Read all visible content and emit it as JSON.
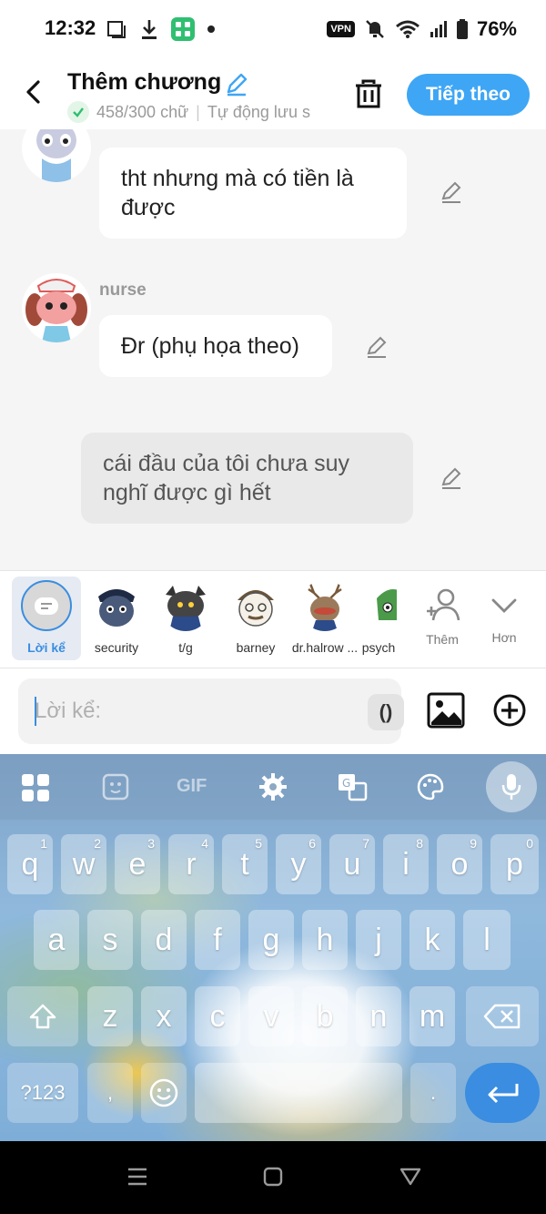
{
  "status_bar": {
    "time": "12:32",
    "vpn": "VPN",
    "battery": "76%"
  },
  "header": {
    "title": "Thêm chương",
    "word_count": "458/300 chữ",
    "autosave": "Tự động lưu s",
    "next_button": "Tiếp theo",
    "accent": "#3ea6f5"
  },
  "chat": {
    "messages": [
      {
        "speaker": "",
        "text": "tht nhưng mà có tiền là được"
      },
      {
        "speaker": "nurse",
        "text": "Đr (phụ họa theo)"
      },
      {
        "speaker": "",
        "text": "cái đầu của tôi chưa suy nghĩ được gì hết"
      }
    ]
  },
  "characters": {
    "items": [
      {
        "label": "Lời kể"
      },
      {
        "label": "security"
      },
      {
        "label": "t/g"
      },
      {
        "label": "barney"
      },
      {
        "label": "dr.halrow ..."
      },
      {
        "label": "psych"
      }
    ],
    "add_label": "Thêm",
    "more_label": "Hơn"
  },
  "composer": {
    "placeholder": "Lời kể:",
    "paren_label": "()"
  },
  "keyboard": {
    "row1": [
      "q",
      "w",
      "e",
      "r",
      "t",
      "y",
      "u",
      "i",
      "o",
      "p"
    ],
    "row1_hints": [
      "1",
      "2",
      "3",
      "4",
      "5",
      "6",
      "7",
      "8",
      "9",
      "0"
    ],
    "row2": [
      "a",
      "s",
      "d",
      "f",
      "g",
      "h",
      "j",
      "k",
      "l"
    ],
    "row3": [
      "z",
      "x",
      "c",
      "v",
      "b",
      "n",
      "m"
    ],
    "symbols_key": "?123",
    "comma_key": ",",
    "period_key": ".",
    "gif_label": "GIF"
  }
}
